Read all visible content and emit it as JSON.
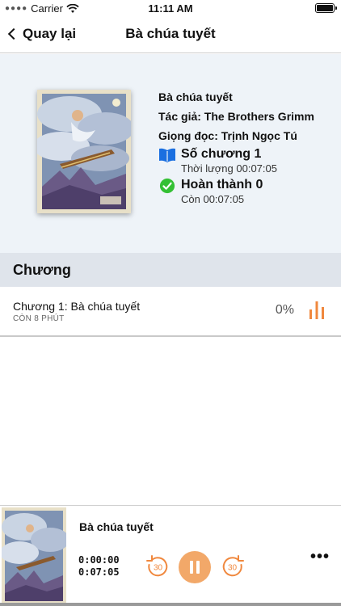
{
  "status_bar": {
    "carrier": "Carrier",
    "time": "11:11 AM"
  },
  "nav": {
    "back_label": "Quay lại",
    "title": "Bà chúa tuyết"
  },
  "book": {
    "name": "Bà chúa tuyết",
    "author": "Tác giả: The Brothers Grimm",
    "narrator": "Giọng đọc: Trịnh Ngọc Tú",
    "chapters_count": "Số chương 1",
    "duration": "Thời lượng 00:07:05",
    "completed": "Hoàn thành 0",
    "remaining": "Còn 00:07:05"
  },
  "section": {
    "title": "Chương"
  },
  "chapters": [
    {
      "title": "Chương 1: Bà chúa tuyết",
      "subtitle": "CÒN 8 PHÚT",
      "progress": "0%"
    }
  ],
  "player": {
    "title": "Bà chúa tuyết",
    "elapsed": "0:00:00",
    "total": "0:07:05",
    "skip_back": "30",
    "skip_forward": "30"
  },
  "colors": {
    "accent_orange": "#f0883e",
    "book_blue": "#1a6fe0",
    "check_green": "#34c034",
    "info_bg": "#eef3f8",
    "section_bg": "#dfe4eb"
  },
  "icons": [
    "wifi-icon",
    "battery-icon",
    "back-chevron-icon",
    "book-icon",
    "check-circle-icon",
    "equalizer-icon",
    "replay-30-icon",
    "forward-30-icon",
    "pause-icon",
    "more-icon"
  ]
}
